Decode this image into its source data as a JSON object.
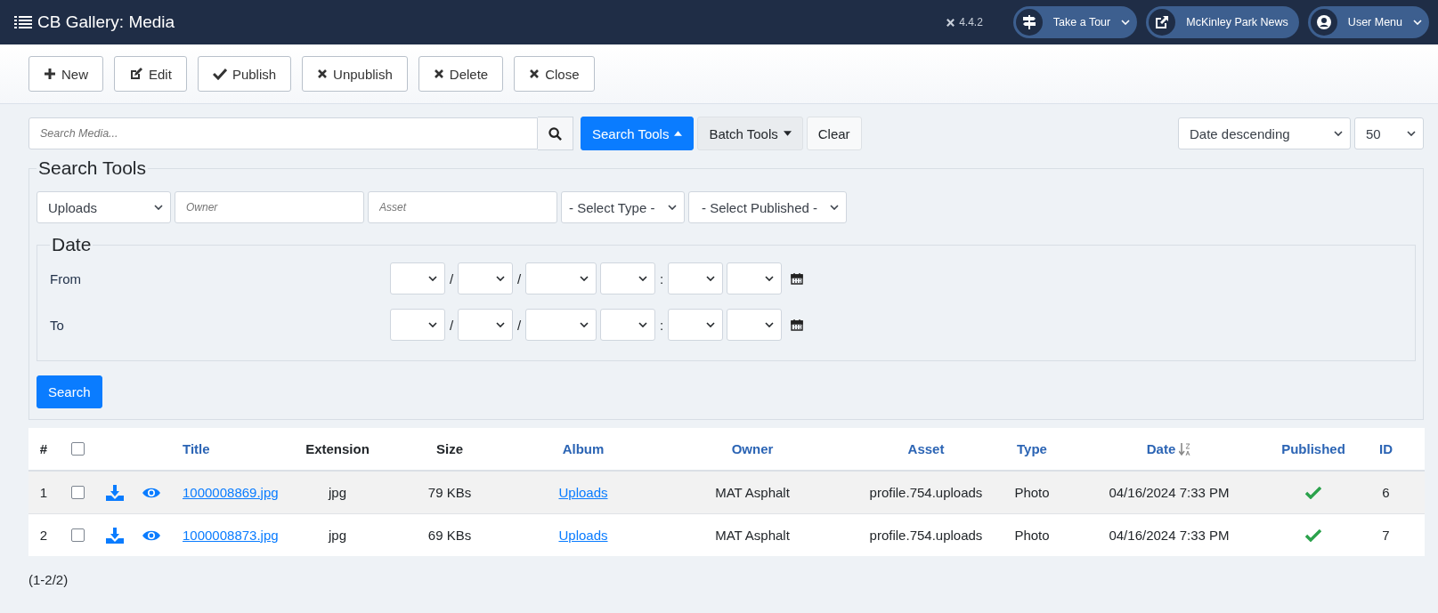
{
  "header": {
    "title": "CB Gallery: Media",
    "version": "4.4.2",
    "pills": [
      {
        "label": "Take a Tour",
        "kind": "signpost",
        "caret": true
      },
      {
        "label": "McKinley Park News",
        "kind": "external",
        "caret": false
      },
      {
        "label": "User Menu",
        "kind": "user",
        "caret": true
      }
    ]
  },
  "toolbar": [
    {
      "label": "New",
      "kind": "plus"
    },
    {
      "label": "Edit",
      "kind": "edit"
    },
    {
      "label": "Publish",
      "kind": "check"
    },
    {
      "label": "Unpublish",
      "kind": "times"
    },
    {
      "label": "Delete",
      "kind": "times"
    },
    {
      "label": "Close",
      "kind": "times"
    }
  ],
  "filter_bar": {
    "search": {
      "placeholder": "Search Media..."
    },
    "search_tools": {
      "label": "Search Tools",
      "selected": true
    },
    "batch_tools": {
      "label": "Batch Tools"
    },
    "clear": "Clear",
    "ordering": "Date descending",
    "limit": "50"
  },
  "search_tools": {
    "legend": "Search Tools",
    "album": "Uploads",
    "owner": {
      "placeholder": "Owner"
    },
    "asset": {
      "placeholder": "Asset"
    },
    "type": "- Select Type -",
    "published": "- Select Published -",
    "date": {
      "legend": "Date",
      "rows": [
        {
          "label": "From",
          "parts": [
            {
              "kind": "select"
            },
            {
              "kind": "separator",
              "text": "/"
            },
            {
              "kind": "select"
            },
            {
              "kind": "separator",
              "text": "/"
            },
            {
              "kind": "wide_select"
            },
            {
              "kind": "select"
            },
            {
              "kind": "separator",
              "text": ":"
            },
            {
              "kind": "select"
            },
            {
              "kind": "select"
            }
          ]
        },
        {
          "label": "To",
          "parts": [
            {
              "kind": "select"
            },
            {
              "kind": "separator",
              "text": "/"
            },
            {
              "kind": "select"
            },
            {
              "kind": "separator",
              "text": "/"
            },
            {
              "kind": "wide_select"
            },
            {
              "kind": "select"
            },
            {
              "kind": "separator",
              "text": ":"
            },
            {
              "kind": "select"
            },
            {
              "kind": "select"
            }
          ]
        }
      ]
    },
    "search_button": "Search"
  },
  "table": {
    "columns": [
      {
        "label": "#",
        "sortable": false,
        "sorted": false
      },
      {
        "label": "Title",
        "sortable": true,
        "sorted": false
      },
      {
        "label": "Extension",
        "sortable": false,
        "sorted": false
      },
      {
        "label": "Size",
        "sortable": false,
        "sorted": false
      },
      {
        "label": "Album",
        "sortable": true,
        "sorted": false
      },
      {
        "label": "Owner",
        "sortable": true,
        "sorted": false
      },
      {
        "label": "Asset",
        "sortable": true,
        "sorted": false
      },
      {
        "label": "Type",
        "sortable": true,
        "sorted": false
      },
      {
        "label": "Date",
        "sortable": true,
        "sorted": true
      },
      {
        "label": "Published",
        "sortable": true,
        "sorted": false
      },
      {
        "label": "ID",
        "sortable": true,
        "sorted": false
      }
    ],
    "all_checked": false,
    "rows": [
      {
        "number": "1",
        "checked": false,
        "title": "1000008869.jpg",
        "extension": "jpg",
        "size": "79 KBs",
        "album": "Uploads",
        "owner": "MAT Asphalt",
        "asset": "profile.754.uploads",
        "type": "Photo",
        "date": "04/16/2024 7:33 PM",
        "published": true,
        "id": "6"
      },
      {
        "number": "2",
        "checked": false,
        "title": "1000008873.jpg",
        "extension": "jpg",
        "size": "69 KBs",
        "album": "Uploads",
        "owner": "MAT Asphalt",
        "asset": "profile.754.uploads",
        "type": "Photo",
        "date": "04/16/2024 7:33 PM",
        "published": true,
        "id": "7"
      }
    ]
  },
  "pagination": "(1-2/2)"
}
